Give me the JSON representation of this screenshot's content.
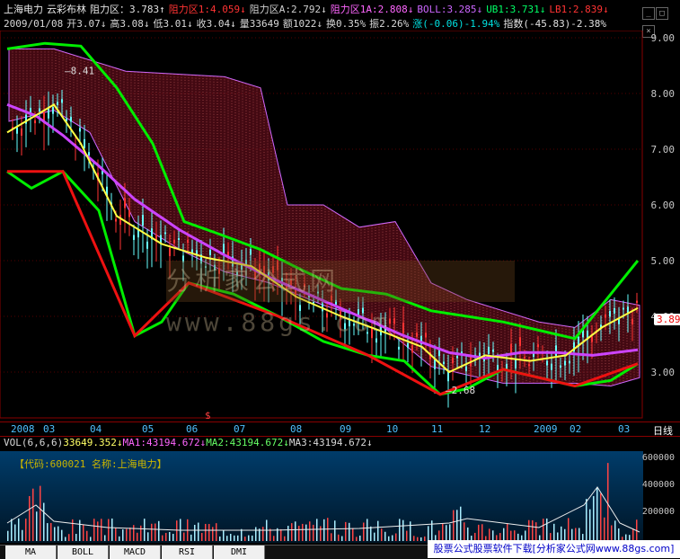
{
  "header_line1": [
    {
      "t": "上海电力",
      "c": "#e8e8e8"
    },
    {
      "t": "云彩布林",
      "c": "#e8e8e8"
    },
    {
      "t": "阻力区：3.783↑",
      "c": "#e0e0e0"
    },
    {
      "t": "阻力区1:4.059↓",
      "c": "#ff3333"
    },
    {
      "t": "阻力区A:2.792↓",
      "c": "#d0d0d0"
    },
    {
      "t": "阻力区1A:2.808↓",
      "c": "#ff66ff"
    },
    {
      "t": "BOLL:3.285↓",
      "c": "#cc66ff"
    },
    {
      "t": "UB1:3.731↓",
      "c": "#00ff66"
    },
    {
      "t": "LB1:2.839↓",
      "c": "#ff3333"
    }
  ],
  "header_line2": [
    {
      "t": "2009/01/08",
      "c": "#d8d8d8"
    },
    {
      "t": "开3.07↓",
      "c": "#d8d8d8"
    },
    {
      "t": "高3.08↓",
      "c": "#d8d8d8"
    },
    {
      "t": "低3.01↓",
      "c": "#d8d8d8"
    },
    {
      "t": "收3.04↓",
      "c": "#d8d8d8"
    },
    {
      "t": "量33649",
      "c": "#d8d8d8"
    },
    {
      "t": "额1022↓",
      "c": "#d8d8d8"
    },
    {
      "t": "换0.35%",
      "c": "#d8d8d8"
    },
    {
      "t": "振2.26%",
      "c": "#d8d8d8"
    },
    {
      "t": "涨(-0.06)-1.94%",
      "c": "#00e0e0"
    },
    {
      "t": "指数(-45.83)-2.38%",
      "c": "#e0e0e0"
    }
  ],
  "price_axis": [
    "9.00",
    "8.00",
    "7.00",
    "6.00",
    "5.00",
    "4.00",
    "3.00"
  ],
  "current_price": "3.89",
  "annotations": {
    "high_label": "8.41",
    "low_label": "2.68",
    "marker": "$"
  },
  "date_axis": [
    "2008",
    "03",
    "04",
    "05",
    "06",
    "07",
    "08",
    "09",
    "10",
    "11",
    "12",
    "2009",
    "02",
    "03",
    "日线"
  ],
  "vol_header": [
    {
      "t": "VOL(6,6,6)",
      "c": "#d8d8d8"
    },
    {
      "t": "33649.352↓",
      "c": "#ffff66"
    },
    {
      "t": "MA1:43194.672↓",
      "c": "#ff66ff"
    },
    {
      "t": "MA2:43194.672↓",
      "c": "#66ff66"
    },
    {
      "t": "MA3:43194.672↓",
      "c": "#d8d8d8"
    }
  ],
  "vol_axis": [
    "600000",
    "400000",
    "200000"
  ],
  "stock_code_label": "【代码:600021 名称:上海电力】",
  "watermark": "分析家公式网 www.88gs.com",
  "tabs": [
    "MA",
    "BOLL",
    "MACD",
    "RSI",
    "DMI"
  ],
  "banner": "股票公式股票软件下载[分析家公式网www.88gs.com]",
  "colors": {
    "upper": "#00ee00",
    "lower": "#ee1111",
    "mid": "#cc44ff",
    "ma": "#ffff44",
    "cloud_red": "#ff6060",
    "cloud_purple": "#cc66ff",
    "up_candle": "#ff3333",
    "down_candle": "#66ffff"
  }
}
